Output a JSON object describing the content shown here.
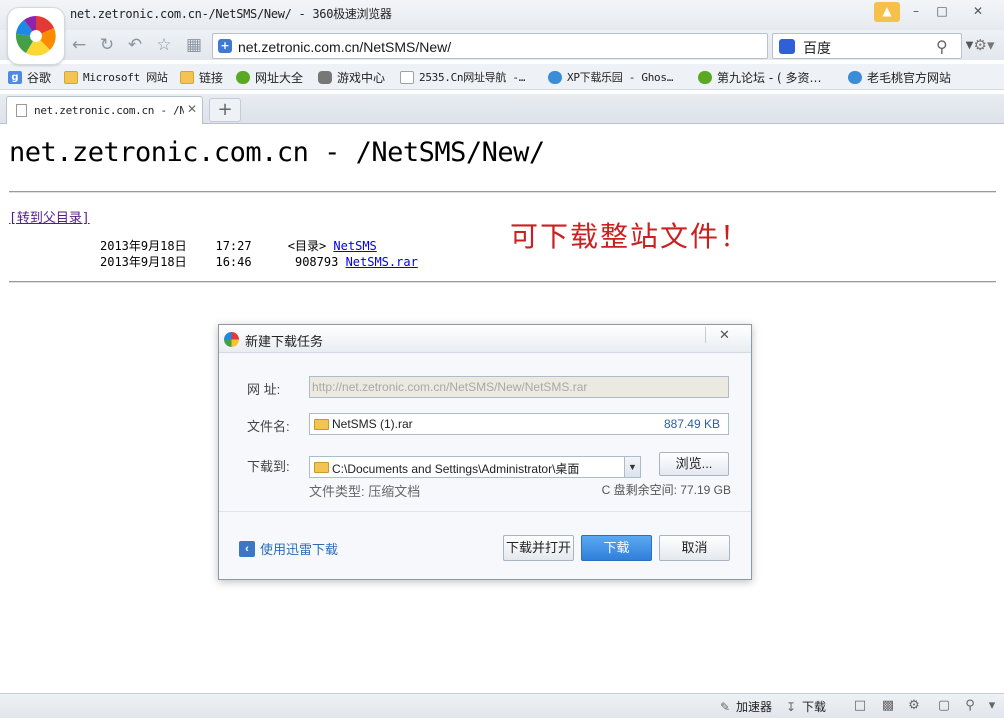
{
  "window": {
    "title": "net.zetronic.com.cn-/NetSMS/New/ - 360极速浏览器"
  },
  "toolbar": {
    "url": "net.zetronic.com.cn/NetSMS/New/",
    "search_engine": "百度"
  },
  "bookmarks": [
    {
      "label": "谷歌",
      "icon": "google-icon"
    },
    {
      "label": "Microsoft 网站",
      "icon": "folder-icon"
    },
    {
      "label": "链接",
      "icon": "folder-icon"
    },
    {
      "label": "网址大全",
      "icon": "green-globe-icon"
    },
    {
      "label": "游戏中心",
      "icon": "gamepad-icon"
    },
    {
      "label": "2535.Cn网址导航 -…",
      "icon": "page-icon"
    },
    {
      "label": "XP下载乐园 - Ghos…",
      "icon": "windows-icon"
    },
    {
      "label": "第九论坛 - ( 多资…",
      "icon": "leaf-icon"
    },
    {
      "label": "老毛桃官方网站",
      "icon": "blue-globe-icon"
    }
  ],
  "tabs": [
    {
      "label": "net.zetronic.com.cn - /NetSMS/New/",
      "active": true
    }
  ],
  "page": {
    "heading": "net.zetronic.com.cn - /NetSMS/New/",
    "parent_link": "[转到父目录]",
    "promo": "可下载整站文件！",
    "listing": [
      {
        "date": "2013年9月18日",
        "time": "17:27",
        "size": "<目录>",
        "name": "NetSMS"
      },
      {
        "date": "2013年9月18日",
        "time": "16:46",
        "size": "908793",
        "name": "NetSMS.rar"
      }
    ]
  },
  "dialog": {
    "title": "新建下载任务",
    "url_label": "网  址:",
    "url_value": "http://net.zetronic.com.cn/NetSMS/New/NetSMS.rar",
    "name_label": "文件名:",
    "name_value": "NetSMS (1).rar",
    "size_value": "887.49 KB",
    "path_label": "下载到:",
    "path_value": "C:\\Documents and Settings\\Administrator\\桌面",
    "browse_label": "浏览...",
    "file_type": "文件类型: 压缩文档",
    "disk_free": "C 盘剩余空间: 77.19 GB",
    "xunlei_label": "使用迅雷下载",
    "btn_open": "下载并打开",
    "btn_download": "下载",
    "btn_cancel": "取消"
  },
  "statusbar": {
    "accelerator": "加速器",
    "download": "下载"
  }
}
